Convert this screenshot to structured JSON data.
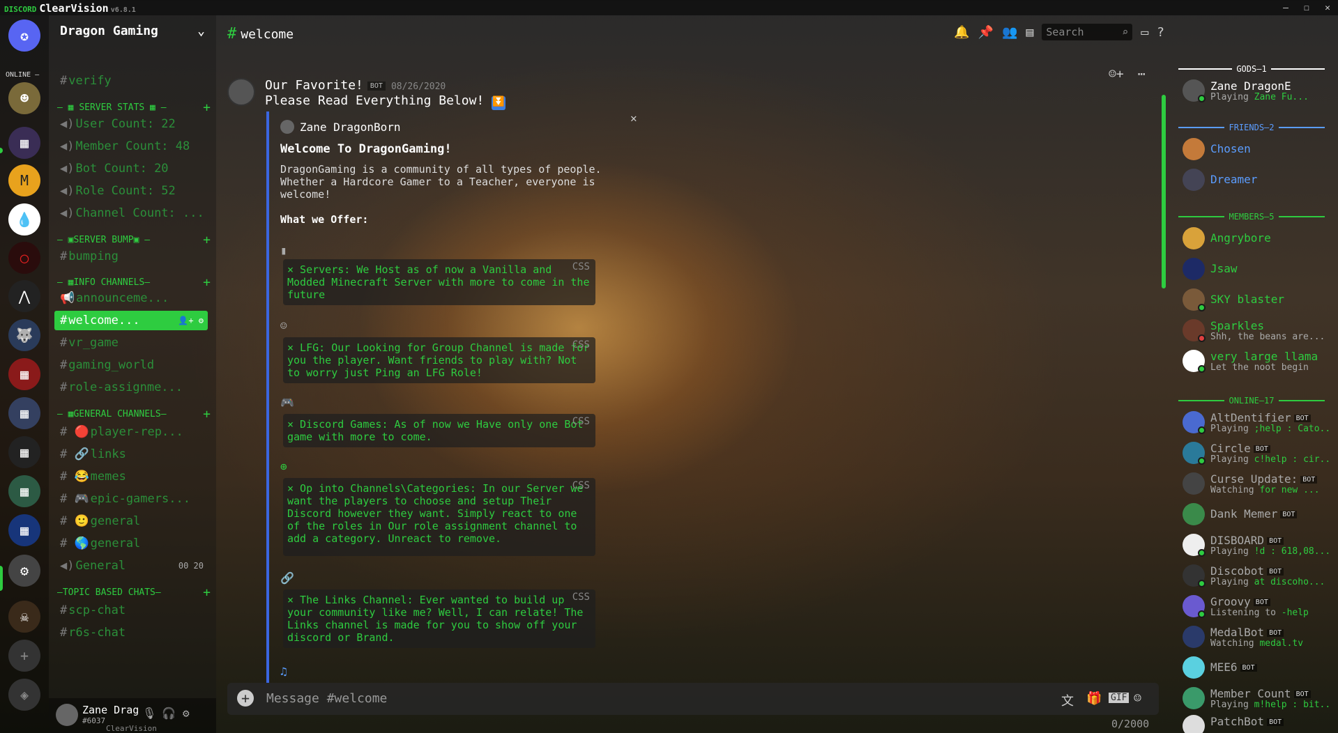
{
  "app": {
    "brand": "DISCORD",
    "theme": "ClearVision",
    "version": "v6.8.1"
  },
  "rail": {
    "online_label": "ONLINE –"
  },
  "guild": {
    "name": "Dragon Gaming"
  },
  "channels": {
    "verify": "verify",
    "cat_stats": "SERVER STATS",
    "user_count": "User Count: 22",
    "member_count": "Member Count: 48",
    "bot_count": "Bot Count: 20",
    "role_count": "Role Count: 52",
    "channel_count": "Channel Count: ...",
    "cat_bump": "SERVER BUMP",
    "bumping": "bumping",
    "cat_info": "INFO CHANNELS",
    "announcements": "announceme...",
    "welcome": "welcome...",
    "vr_game": "vr_game",
    "gaming_world": "gaming_world",
    "role_assign": "role-assignme...",
    "cat_general": "GENERAL CHANNELS",
    "player_rep": "player-rep...",
    "links": "links",
    "memes": "memes",
    "epic_gamers": "epic-gamers...",
    "general1": "general",
    "general2": "general",
    "general_voice": "General",
    "general_voice_count": "00 20",
    "cat_topic": "TOPIC BASED CHATS",
    "scp_chat": "scp-chat",
    "r6s_chat": "r6s-chat"
  },
  "user": {
    "name": "Zane Drag",
    "tag": "#6037",
    "theme_label": "ClearVision"
  },
  "chat": {
    "channel_name": "welcome",
    "search_placeholder": "Search",
    "message": {
      "author": "Our Favorite!",
      "badge": "BOT",
      "timestamp": "08/26/2020",
      "text": "Please Read Everything Below!"
    },
    "embed": {
      "author": "Zane DragonBorn",
      "title": "Welcome To DragonGaming!",
      "description": "DragonGaming is a community of all types of people. Whether a Hardcore Gamer to a Teacher, everyone is welcome!",
      "offer_heading": "What we Offer:",
      "code_lang": "CSS",
      "blocks": [
        "× Servers: We Host as of now a Vanilla and Modded Minecraft Server with more to come in the future",
        "× LFG: Our Looking for Group Channel is made for you the player. Want friends to play with? Not to worry just Ping an LFG Role!",
        "× Discord Games: As of now we Have only one Bot game with more to come.",
        "× Op into Channels\\Categories: In our Server we want the players to choose and setup Their Discord however they want. Simply react to one of the roles in Our role assignment channel to add a category. Unreact to remove.",
        "× The Links Channel: Ever wanted to build up your community like me? Well, I can relate! The Links channel is made for you to show off your discord or Brand."
      ]
    },
    "composer_placeholder": "Message #welcome",
    "char_counter": "0/2000"
  },
  "members": {
    "groups": [
      {
        "label": "GODS—1"
      },
      {
        "label": "FRIENDS—2"
      },
      {
        "label": "MEMBERS—5"
      },
      {
        "label": "ONLINE—17"
      }
    ],
    "gods": [
      {
        "name": "Zane DragonE",
        "activity_prefix": "Playing",
        "activity": "Zane Fu..."
      }
    ],
    "friends": [
      {
        "name": "Chosen"
      },
      {
        "name": "Dreamer"
      }
    ],
    "members": [
      {
        "name": "Angrybore"
      },
      {
        "name": "Jsaw"
      },
      {
        "name": "SKY blaster"
      },
      {
        "name": "Sparkles",
        "status": "Shh, the beans are..."
      },
      {
        "name": "very large llama",
        "status": "Let the noot begin"
      }
    ],
    "online": [
      {
        "name": "AltDentifier",
        "badge": "BOT",
        "prefix": "Playing",
        "activity": ";help : Cato..."
      },
      {
        "name": "Circle",
        "badge": "BOT",
        "prefix": "Playing",
        "activity": "c!help : cir..."
      },
      {
        "name": "Curse Update:",
        "badge": "BOT",
        "prefix": "Watching",
        "activity": "for new ..."
      },
      {
        "name": "Dank Memer",
        "badge": "BOT",
        "prefix": "",
        "activity": ""
      },
      {
        "name": "DISBOARD",
        "badge": "BOT",
        "prefix": "Playing",
        "activity": "!d : 618,08..."
      },
      {
        "name": "Discobot",
        "badge": "BOT",
        "prefix": "Playing",
        "activity": "at discoho..."
      },
      {
        "name": "Groovy",
        "badge": "BOT",
        "prefix": "Listening to",
        "activity": "-help"
      },
      {
        "name": "MedalBot",
        "badge": "BOT",
        "prefix": "Watching",
        "activity": "medal.tv"
      },
      {
        "name": "MEE6",
        "badge": "BOT",
        "prefix": "",
        "activity": ""
      },
      {
        "name": "Member Count",
        "badge": "BOT",
        "prefix": "Playing",
        "activity": "m!help : bit..."
      },
      {
        "name": "PatchBot",
        "badge": "BOT",
        "prefix": "",
        "activity": ""
      }
    ]
  },
  "colors": {
    "accent": "#2ecc40",
    "embed_bar": "#3b66e0",
    "friends": "#5b9dff"
  }
}
